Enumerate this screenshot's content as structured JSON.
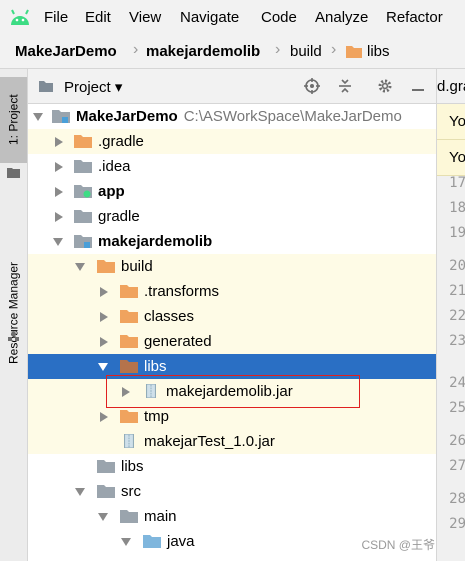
{
  "menu": [
    "File",
    "Edit",
    "View",
    "Navigate",
    "Code",
    "Analyze",
    "Refactor"
  ],
  "breadcrumb": {
    "items": [
      "MakeJarDemo",
      "makejardemolib",
      "build",
      "libs"
    ]
  },
  "side_strip": {
    "project_tab": "1: Project",
    "resource_tab": "Resource Manager"
  },
  "panel": {
    "title": "Project",
    "dropdown": "▾"
  },
  "tree": [
    {
      "label": "MakeJarDemo",
      "path": "C:\\ASWorkSpace\\MakeJarDemo"
    },
    {
      "label": ".gradle"
    },
    {
      "label": ".idea"
    },
    {
      "label": "app"
    },
    {
      "label": "gradle"
    },
    {
      "label": "makejardemolib"
    },
    {
      "label": "build"
    },
    {
      "label": ".transforms"
    },
    {
      "label": "classes"
    },
    {
      "label": "generated"
    },
    {
      "label": "libs"
    },
    {
      "label": "makejardemolib.jar"
    },
    {
      "label": "tmp"
    },
    {
      "label": "makejarTest_1.0.jar"
    },
    {
      "label": "libs"
    },
    {
      "label": "src"
    },
    {
      "label": "main"
    },
    {
      "label": "java"
    }
  ],
  "editor": {
    "tab": "d.gra",
    "banner1": "Yo",
    "banner2": "Yo",
    "line_numbers": [
      "17",
      "18",
      "19",
      "20",
      "21",
      "22",
      "23",
      "24",
      "25",
      "26",
      "27",
      "28",
      "29"
    ]
  },
  "watermark": "CSDN @王爷",
  "colors": {
    "selection": "#2a6fc4",
    "highlight": "#fefbe6",
    "folder_orange": "#f0a35e",
    "folder_blue": "#7fb6dd",
    "folder_gray": "#9aa4ad",
    "android_green": "#3ddc84"
  }
}
